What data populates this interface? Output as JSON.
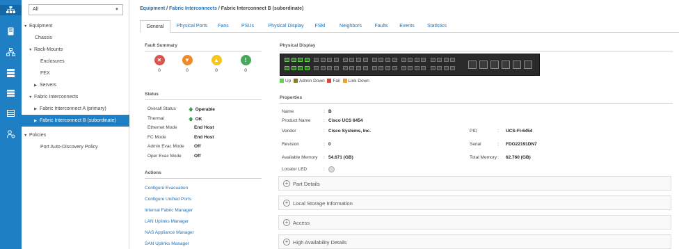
{
  "rail": {
    "icons": [
      "network-icon",
      "server-icon",
      "topology-icon",
      "storage-icon",
      "list-icon",
      "table-icon",
      "admin-icon"
    ]
  },
  "nav": {
    "filter_value": "All",
    "tree": [
      {
        "label": "Equipment",
        "level": 0,
        "arrow": "▼"
      },
      {
        "label": "Chassis",
        "level": 1,
        "arrow": ""
      },
      {
        "label": "Rack-Mounts",
        "level": 1,
        "arrow": "▼"
      },
      {
        "label": "Enclosures",
        "level": 2,
        "arrow": ""
      },
      {
        "label": "FEX",
        "level": 2,
        "arrow": ""
      },
      {
        "label": "Servers",
        "level": 2,
        "arrow": "▶"
      },
      {
        "label": "Fabric Interconnects",
        "level": 1,
        "arrow": "▼"
      },
      {
        "label": "Fabric Interconnect A (primary)",
        "level": 2,
        "arrow": "▶"
      },
      {
        "label": "Fabric Interconnect B (subordinate)",
        "level": 2,
        "arrow": "▶",
        "selected": true
      },
      {
        "label": "Policies",
        "level": 0,
        "arrow": "▼"
      },
      {
        "label": "Port Auto-Discovery Policy",
        "level": 1,
        "arrow": ""
      }
    ]
  },
  "breadcrumb": {
    "p1": "Equipment",
    "sep": " / ",
    "p2": "Fabric Interconnects",
    "p3": "Fabric Interconnect B (subordinate)"
  },
  "tabs": [
    "General",
    "Physical Ports",
    "Fans",
    "PSUs",
    "Physical Display",
    "FSM",
    "Neighbors",
    "Faults",
    "Events",
    "Statistics"
  ],
  "fault_summary": {
    "title": "Fault Summary",
    "items": [
      {
        "name": "critical",
        "glyph": "✕",
        "color": "#d9534f",
        "count": "0"
      },
      {
        "name": "major",
        "glyph": "▼",
        "color": "#f08a24",
        "count": "0"
      },
      {
        "name": "minor",
        "glyph": "▲",
        "color": "#f5c518",
        "count": "0"
      },
      {
        "name": "warning",
        "glyph": "!",
        "color": "#46a85a",
        "count": "0"
      }
    ]
  },
  "status": {
    "title": "Status",
    "rows": [
      {
        "label": "Overall Status",
        "value": "Operable",
        "arrow": true
      },
      {
        "label": "Thermal",
        "value": "OK",
        "arrow": true
      },
      {
        "label": "Ethernet Mode",
        "value": "End Host"
      },
      {
        "label": "FC Mode",
        "value": "End Host"
      },
      {
        "label": "Admin Evac Mode",
        "value": "Off"
      },
      {
        "label": "Oper Evac Mode",
        "value": "Off"
      }
    ]
  },
  "actions": {
    "title": "Actions",
    "links": [
      "Configure Evacuation",
      "Configure Unified Ports",
      "Internal Fabric Manager",
      "LAN Uplinks Manager",
      "NAS Appliance Manager",
      "SAN Uplinks Manager"
    ]
  },
  "physical_display": {
    "title": "Physical Display",
    "legend": [
      {
        "label": "Up",
        "color": "#62d34e"
      },
      {
        "label": "Admin Down",
        "color": "#8a7b2a"
      },
      {
        "label": "Fail",
        "color": "#e0433a"
      },
      {
        "label": "Link Down",
        "color": "#f0a030"
      }
    ]
  },
  "properties": {
    "title": "Properties",
    "rows": [
      {
        "label": "Name",
        "value": "B"
      },
      {
        "label": "Product Name",
        "value": "Cisco UCS 6454"
      },
      {
        "label": "Vendor",
        "value": "Cisco Systems, Inc."
      },
      {
        "label": "Revision",
        "value": "0"
      },
      {
        "label": "Available Memory",
        "value": "54.671 (GB)"
      },
      {
        "label": "Locator LED",
        "value": ""
      }
    ],
    "right_rows": [
      {
        "label": "PID",
        "value": "UCS-FI-6454"
      },
      {
        "label": "Serial",
        "value": "FDO22191DN7"
      },
      {
        "label": "Total Memory",
        "value": "62.760 (GB)"
      }
    ]
  },
  "accordions": [
    "Part Details",
    "Local Storage Information",
    "Access",
    "High Availability Details"
  ]
}
